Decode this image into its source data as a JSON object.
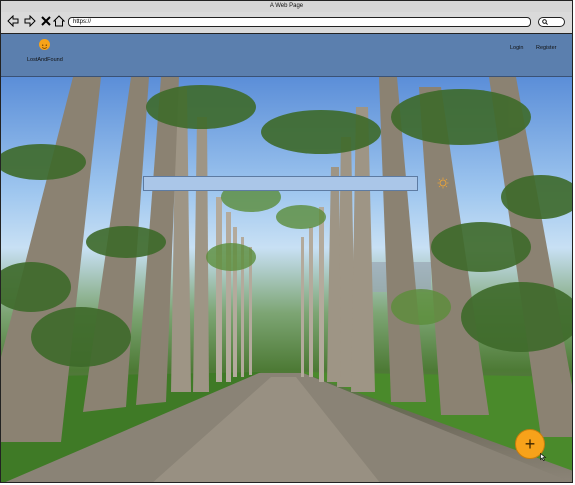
{
  "browser": {
    "title": "A Web Page",
    "address": "https://",
    "icons": [
      "back-arrow-icon",
      "forward-arrow-icon",
      "close-icon",
      "home-icon",
      "search-icon"
    ]
  },
  "header": {
    "logo_text": "LostAndFound",
    "logo_icon": "smiley-icon",
    "nav": {
      "login": "Login",
      "register": "Register"
    }
  },
  "hero": {
    "image": "avenue-of-royal-palm-trees",
    "search_icon": "sun-icon"
  },
  "fab": {
    "label": "+"
  },
  "colors": {
    "header_bg": "#5b7fae",
    "accent": "#f7a21a",
    "search_bar_bg": "#aac6e8"
  }
}
